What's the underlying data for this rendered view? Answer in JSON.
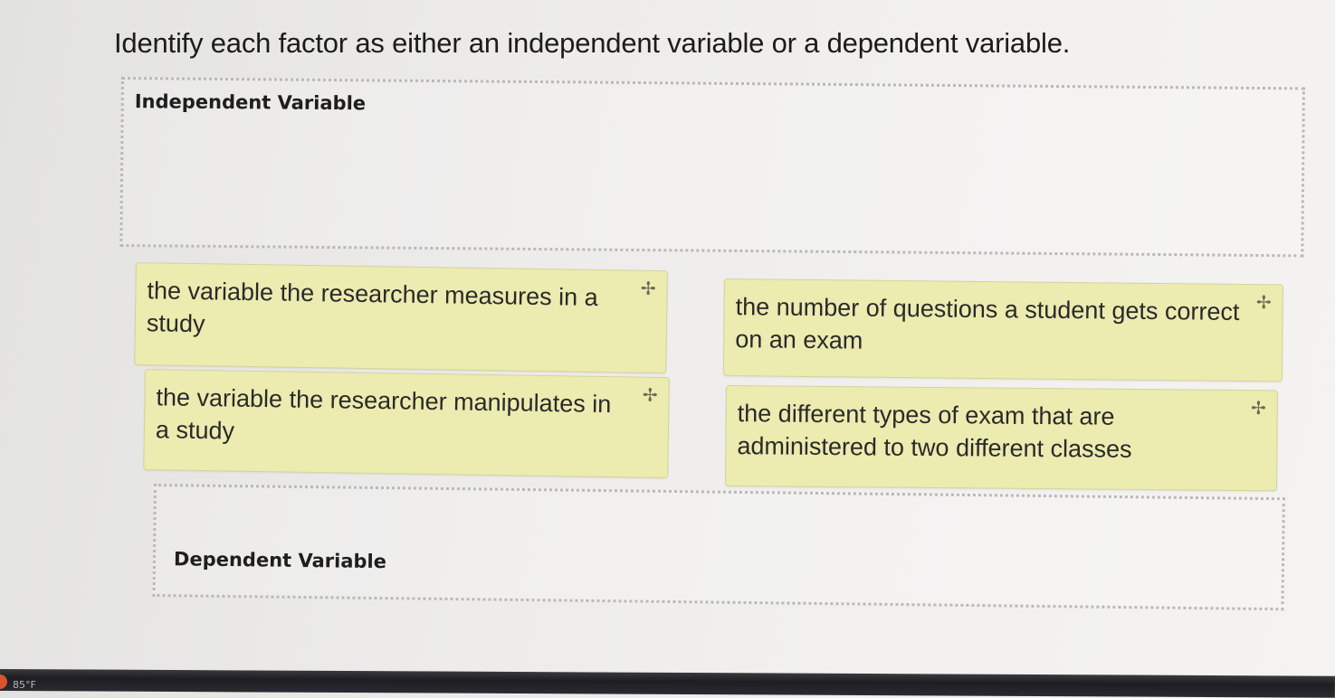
{
  "question": {
    "text": "Identify each factor as either an independent variable or a dependent variable."
  },
  "zones": {
    "independent": {
      "label": "Independent Variable"
    },
    "dependent": {
      "label": "Dependent Variable"
    }
  },
  "tiles": [
    {
      "text": "the variable the researcher measures in a study",
      "icon": "move-icon"
    },
    {
      "text": "the number of questions a student gets correct on an exam",
      "icon": "move-icon"
    },
    {
      "text": "the variable the researcher manipulates in a study",
      "icon": "move-icon"
    },
    {
      "text": "the different types of exam that are administered to two different classes",
      "icon": "move-icon"
    }
  ],
  "taskbar": {
    "temperature": "85°F"
  },
  "colors": {
    "tile_background": "#ecebb0",
    "zone_border": "#b9b9b6",
    "weather_icon": "#d9532b"
  }
}
